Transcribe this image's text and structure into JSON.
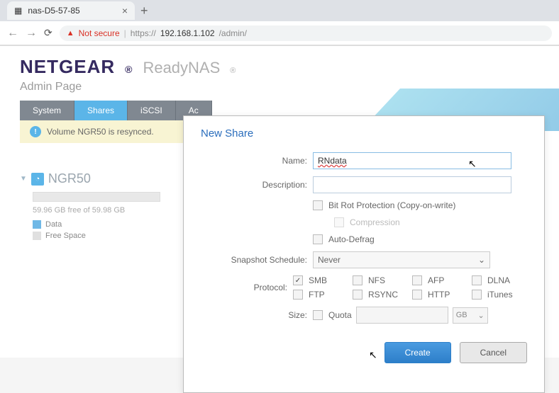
{
  "browser": {
    "tab_title": "nas-D5-57-85",
    "not_secure": "Not secure",
    "url_proto": "https://",
    "url_host": "192.168.1.102",
    "url_path": "/admin/"
  },
  "brand": {
    "main": "NETGEAR",
    "sub": "ReadyNAS"
  },
  "admin_label": "Admin Page",
  "tabs": {
    "system": "System",
    "shares": "Shares",
    "iscsi": "iSCSI",
    "ac": "Ac"
  },
  "alert": "Volume NGR50 is resynced.",
  "volume": {
    "name": "NGR50",
    "stat": "59.96 GB free of 59.98 GB",
    "legend_data": "Data",
    "legend_free": "Free Space"
  },
  "modal": {
    "title": "New Share",
    "labels": {
      "name": "Name:",
      "description": "Description:",
      "bitrot": "Bit Rot Protection (Copy-on-write)",
      "compression": "Compression",
      "autodefrag": "Auto-Defrag",
      "snapshot": "Snapshot Schedule:",
      "protocol": "Protocol:",
      "size": "Size:",
      "quota": "Quota",
      "unit": "GB"
    },
    "name_value": "RNdata",
    "snapshot_value": "Never",
    "protocols": {
      "smb": "SMB",
      "nfs": "NFS",
      "afp": "AFP",
      "dlna": "DLNA",
      "ftp": "FTP",
      "rsync": "RSYNC",
      "http": "HTTP",
      "itunes": "iTunes"
    },
    "buttons": {
      "create": "Create",
      "cancel": "Cancel"
    }
  }
}
